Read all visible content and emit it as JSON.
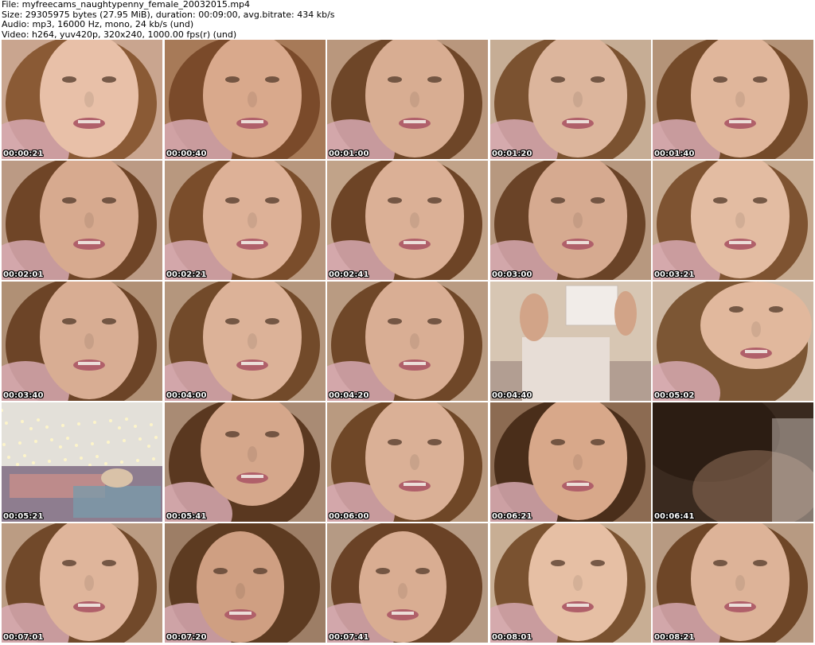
{
  "header": {
    "file_line": "File: myfreecams_naughtypenny_female_20032015.mp4",
    "size_line": "Size: 29305975 bytes (27.95 MiB), duration: 00:09:00, avg.bitrate: 434 kb/s",
    "audio_line": "Audio: mp3, 16000 Hz, mono, 24 kb/s (und)",
    "video_line": "Video: h264, yuv420p, 320x240, 1000.00 fps(r) (und)"
  },
  "thumbnails": [
    {
      "time": "00:00:21",
      "scene": "face-closeup",
      "bg": "#c9a58f",
      "skin": "#e8c0a8",
      "hair": "#8a5a35"
    },
    {
      "time": "00:00:40",
      "scene": "face-closeup",
      "bg": "#a77a58",
      "skin": "#d9a98c",
      "hair": "#7a4a2a"
    },
    {
      "time": "00:01:00",
      "scene": "face-closeup",
      "bg": "#b9977d",
      "skin": "#d8ad92",
      "hair": "#6e4628"
    },
    {
      "time": "00:01:20",
      "scene": "face-closeup",
      "bg": "#c6ad95",
      "skin": "#dcb59c",
      "hair": "#7b5230"
    },
    {
      "time": "00:01:40",
      "scene": "face-closeup",
      "bg": "#b49378",
      "skin": "#e0b69b",
      "hair": "#744a29"
    },
    {
      "time": "00:02:01",
      "scene": "face-closeup",
      "bg": "#bb9a84",
      "skin": "#d7aa8f",
      "hair": "#6f4527"
    },
    {
      "time": "00:02:21",
      "scene": "face-closeup",
      "bg": "#b8987f",
      "skin": "#ddb197",
      "hair": "#7a4d2b"
    },
    {
      "time": "00:02:41",
      "scene": "face-closeup",
      "bg": "#c1a389",
      "skin": "#dbb096",
      "hair": "#6d4426"
    },
    {
      "time": "00:03:00",
      "scene": "face-closeup",
      "bg": "#b7987f",
      "skin": "#d6aa90",
      "hair": "#6a4327"
    },
    {
      "time": "00:03:21",
      "scene": "face-closeup",
      "bg": "#c5a98f",
      "skin": "#e3bca2",
      "hair": "#7e5331"
    },
    {
      "time": "00:03:40",
      "scene": "face-closeup",
      "bg": "#b09075",
      "skin": "#d8ad93",
      "hair": "#6c4427"
    },
    {
      "time": "00:04:00",
      "scene": "face-closeup",
      "bg": "#b4967d",
      "skin": "#dcb298",
      "hair": "#724a2a"
    },
    {
      "time": "00:04:20",
      "scene": "face-closeup",
      "bg": "#b99b82",
      "skin": "#d9ae94",
      "hair": "#6f4728"
    },
    {
      "time": "00:04:40",
      "scene": "room-tablet",
      "bg": "#d7c6b3",
      "skin": "#d2a488",
      "hair": "#7b5230"
    },
    {
      "time": "00:05:02",
      "scene": "face-tilted",
      "bg": "#cdb7a2",
      "skin": "#e1b89d",
      "hair": "#7c5634"
    },
    {
      "time": "00:05:21",
      "scene": "bed-lights",
      "bg": "#e3e0d9",
      "skin": "#d8c8b6",
      "hair": "#8a6e55"
    },
    {
      "time": "00:05:41",
      "scene": "face-blurred",
      "bg": "#a98b74",
      "skin": "#d5a78b",
      "hair": "#5a3820"
    },
    {
      "time": "00:06:00",
      "scene": "face-closeup",
      "bg": "#b99a80",
      "skin": "#dab096",
      "hair": "#6f4727"
    },
    {
      "time": "00:06:21",
      "scene": "face-closeup",
      "bg": "#8c6b52",
      "skin": "#d8a88a",
      "hair": "#4a2e1a"
    },
    {
      "time": "00:06:41",
      "scene": "dark-blur",
      "bg": "#3a2a1f",
      "skin": "#8a6a55",
      "hair": "#2b1c12"
    },
    {
      "time": "00:07:01",
      "scene": "face-closeup",
      "bg": "#bb9c83",
      "skin": "#dfb59b",
      "hair": "#71492a"
    },
    {
      "time": "00:07:20",
      "scene": "face-side",
      "bg": "#9d7e66",
      "skin": "#cf9f82",
      "hair": "#5d3b21"
    },
    {
      "time": "00:07:41",
      "scene": "face-side",
      "bg": "#b59a84",
      "skin": "#d9ad92",
      "hair": "#6a4226"
    },
    {
      "time": "00:08:01",
      "scene": "face-closeup",
      "bg": "#c8ae94",
      "skin": "#e6bfa4",
      "hair": "#7a5230"
    },
    {
      "time": "00:08:21",
      "scene": "face-closeup",
      "bg": "#b79a82",
      "skin": "#ddb398",
      "hair": "#6e4627"
    }
  ]
}
